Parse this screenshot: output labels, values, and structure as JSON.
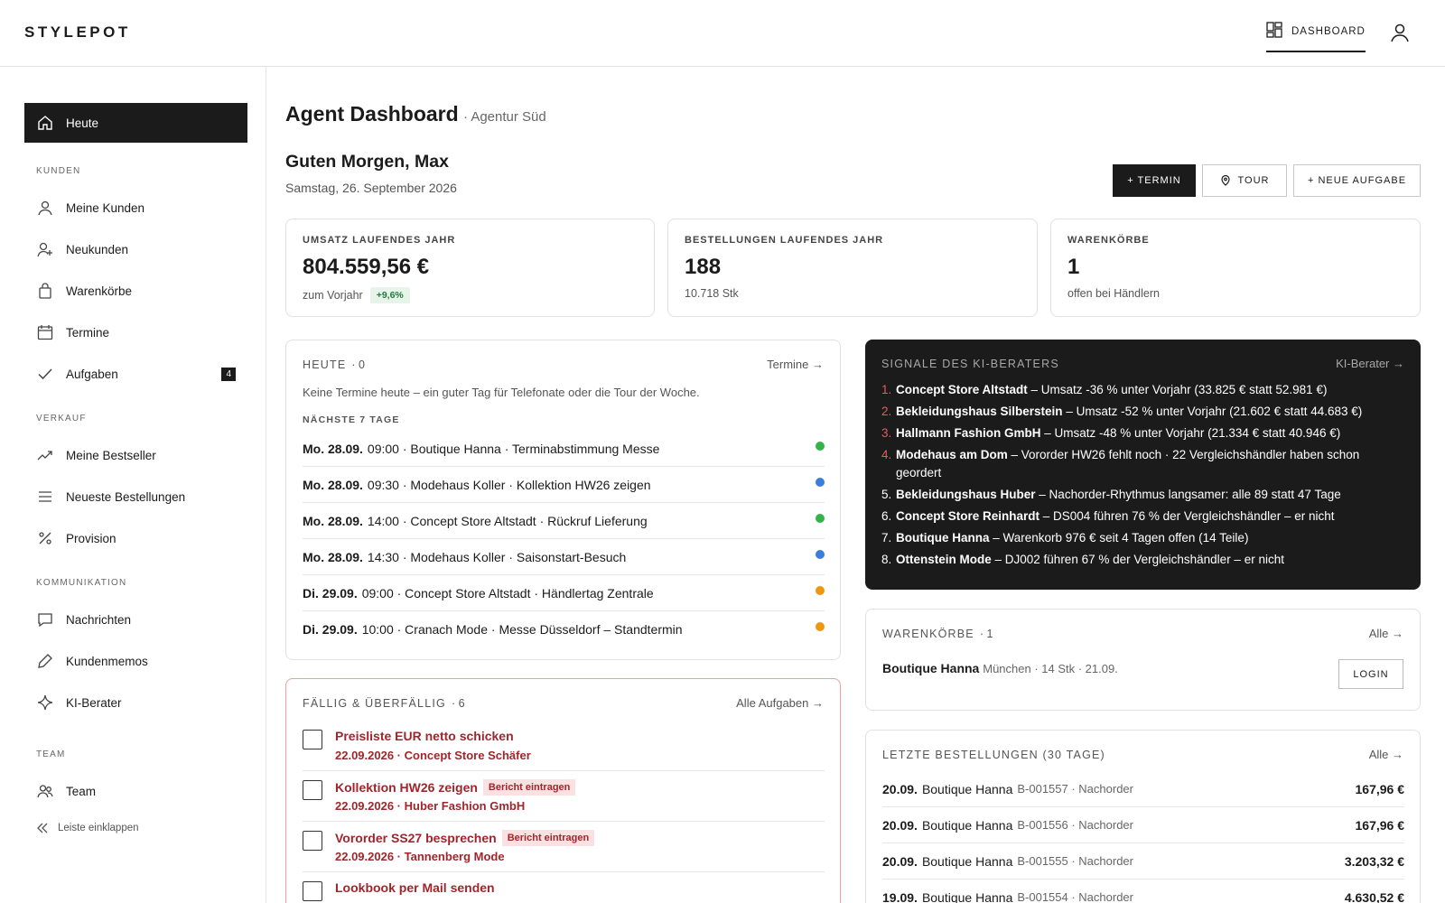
{
  "header": {
    "logo": "STYLEPOT",
    "dashboard_label": "DASHBOARD"
  },
  "sidebar": {
    "home": "Heute",
    "sections": {
      "kunden": "KUNDEN",
      "verkauf": "VERKAUF",
      "kommunikation": "KOMMUNIKATION",
      "team": "TEAM"
    },
    "items": {
      "meine_kunden": "Meine Kunden",
      "neukunden": "Neukunden",
      "warenkoerbe": "Warenkörbe",
      "termine": "Termine",
      "aufgaben": "Aufgaben",
      "aufgaben_badge": "4",
      "bestseller": "Meine Bestseller",
      "bestellungen": "Neueste Bestellungen",
      "provision": "Provision",
      "nachrichten": "Nachrichten",
      "kundenmemos": "Kundenmemos",
      "ki_berater": "KI-Berater",
      "team": "Team"
    },
    "collapse": "Leiste einklappen"
  },
  "main": {
    "title": "Agent Dashboard",
    "subtitle": "· Agentur Süd",
    "greeting": "Guten Morgen, Max",
    "date": "Samstag, 26. September 2026",
    "buttons": {
      "termin": "+ TERMIN",
      "tour": "TOUR",
      "aufgabe": "+ NEUE AUFGABE"
    }
  },
  "kpis": [
    {
      "label": "UMSATZ LAUFENDES JAHR",
      "value": "804.559,56 €",
      "sub": "zum Vorjahr",
      "delta": "+9,6%"
    },
    {
      "label": "BESTELLUNGEN LAUFENDES JAHR",
      "value": "188",
      "sub": "10.718 Stk"
    },
    {
      "label": "WARENKÖRBE",
      "value": "1",
      "sub": "offen bei Händlern"
    }
  ],
  "today": {
    "title": "HEUTE",
    "count": "· 0",
    "link": "Termine →",
    "empty": "Keine Termine heute – ein guter Tag für Telefonate oder die Tour der Woche.",
    "next_label": "NÄCHSTE 7 TAGE",
    "appointments": [
      {
        "day": "Mo. 28.09.",
        "text": "09:00 · Boutique Hanna · Terminabstimmung Messe",
        "color": "#34b34a"
      },
      {
        "day": "Mo. 28.09.",
        "text": "09:30 · Modehaus Koller · Kollektion HW26 zeigen",
        "color": "#3b7ddd"
      },
      {
        "day": "Mo. 28.09.",
        "text": "14:00 · Concept Store Altstadt · Rückruf Lieferung",
        "color": "#34b34a"
      },
      {
        "day": "Mo. 28.09.",
        "text": "14:30 · Modehaus Koller · Saisonstart-Besuch",
        "color": "#3b7ddd"
      },
      {
        "day": "Di. 29.09.",
        "text": "09:00 · Concept Store Altstadt · Händlertag Zentrale",
        "color": "#f0960e"
      },
      {
        "day": "Di. 29.09.",
        "text": "10:00 · Cranach Mode · Messe Düsseldorf – Standtermin",
        "color": "#f0960e"
      }
    ]
  },
  "tasks": {
    "title": "FÄLLIG & ÜBERFÄLLIG",
    "count": "· 6",
    "link": "Alle Aufgaben →",
    "items": [
      {
        "title": "Preisliste EUR netto schicken",
        "tag": "",
        "meta": "22.09.2026 · Concept Store Schäfer"
      },
      {
        "title": "Kollektion HW26 zeigen",
        "tag": "Bericht eintragen",
        "meta": "22.09.2026 · Huber Fashion GmbH"
      },
      {
        "title": "Vororder SS27 besprechen",
        "tag": "Bericht eintragen",
        "meta": "22.09.2026 · Tannenberg Mode"
      },
      {
        "title": "Lookbook per Mail senden",
        "tag": "",
        "meta": ""
      }
    ]
  },
  "signals": {
    "title": "SIGNALE DES KI-BERATERS",
    "link": "KI-Berater →",
    "items": [
      {
        "n": "1.",
        "name": "Concept Store Altstadt",
        "text": " – Umsatz -36 % unter Vorjahr (33.825 € statt 52.981 €)",
        "alert": true
      },
      {
        "n": "2.",
        "name": "Bekleidungshaus Silberstein",
        "text": " – Umsatz -52 % unter Vorjahr (21.602 € statt 44.683 €)",
        "alert": true
      },
      {
        "n": "3.",
        "name": "Hallmann Fashion GmbH",
        "text": " – Umsatz -48 % unter Vorjahr (21.334 € statt 40.946 €)",
        "alert": true
      },
      {
        "n": "4.",
        "name": "Modehaus am Dom",
        "text": " – Vororder HW26 fehlt noch · 22 Vergleichshändler haben schon geordert",
        "alert": true
      },
      {
        "n": "5.",
        "name": "Bekleidungshaus Huber",
        "text": " – Nachorder-Rhythmus langsamer: alle 89 statt 47 Tage",
        "alert": false
      },
      {
        "n": "6.",
        "name": "Concept Store Reinhardt",
        "text": " – DS004 führen 76 % der Vergleichshändler – er nicht",
        "alert": false
      },
      {
        "n": "7.",
        "name": "Boutique Hanna",
        "text": " – Warenkorb 976 € seit 4 Tagen offen (14 Teile)",
        "alert": false
      },
      {
        "n": "8.",
        "name": "Ottenstein Mode",
        "text": " – DJ002 führen 67 % der Vergleichshändler – er nicht",
        "alert": false
      }
    ]
  },
  "carts": {
    "title": "WARENKÖRBE",
    "count": "· 1",
    "link": "Alle →",
    "name": "Boutique Hanna",
    "meta": "München · 14 Stk · 21.09.",
    "login": "LOGIN"
  },
  "orders": {
    "title": "LETZTE BESTELLUNGEN (30 TAGE)",
    "link": "Alle →",
    "items": [
      {
        "date": "20.09.",
        "shop": "Boutique Hanna",
        "no": "B-001557 · Nachorder",
        "amount": "167,96 €"
      },
      {
        "date": "20.09.",
        "shop": "Boutique Hanna",
        "no": "B-001556 · Nachorder",
        "amount": "167,96 €"
      },
      {
        "date": "20.09.",
        "shop": "Boutique Hanna",
        "no": "B-001555 · Nachorder",
        "amount": "3.203,32 €"
      },
      {
        "date": "19.09.",
        "shop": "Boutique Hanna",
        "no": "B-001554 · Nachorder",
        "amount": "4.630,52 €"
      }
    ]
  },
  "icons": [
    "home-icon",
    "user-icon",
    "user-plus-icon",
    "bag-icon",
    "calendar-icon",
    "check-icon",
    "trend-icon",
    "list-icon",
    "percent-icon",
    "message-icon",
    "pencil-icon",
    "sparkle-icon",
    "team-icon",
    "chevrons-left-icon",
    "grid-icon",
    "pin-icon"
  ]
}
